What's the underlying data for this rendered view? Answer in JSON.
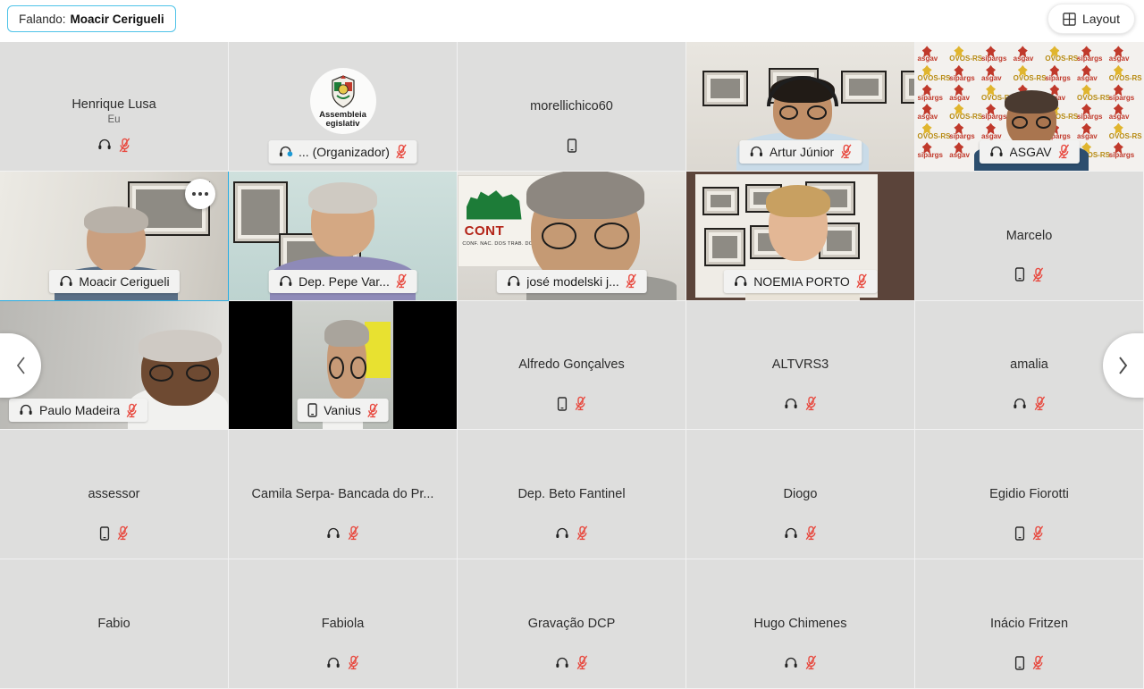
{
  "header": {
    "speaking_prefix": "Falando:",
    "speaking_name": "Moacir Cerigueli",
    "layout_label": "Layout",
    "layout_icon": "grid-layout-icon",
    "badge_border_color": "#4fc3e8"
  },
  "colors": {
    "active_speaker_border": "#2aace2",
    "muted_mic": "#e8493f",
    "tile_background": "#dededd",
    "plate_background": "#f2f2f1"
  },
  "nav": {
    "prev_label": "‹",
    "prev_icon": "chevron-left-icon",
    "next_label": "›",
    "next_icon": "chevron-right-icon"
  },
  "tile_menu": {
    "icon": "more-options-icon",
    "label": "..."
  },
  "grid": {
    "columns": 5,
    "rows": 5,
    "tiles": [
      {
        "name": "Henrique Lusa",
        "subtitle": "Eu",
        "video": false,
        "plate": false,
        "icons": [
          "headset-icon",
          "mic-muted-icon"
        ],
        "active_speaker": false
      },
      {
        "name": "... (Organizador)",
        "video": false,
        "plate": true,
        "avatar": "assembleia-legislativa-logo",
        "avatar_text": "Assembleia Legislativa",
        "icons": [
          "headset-active-icon",
          "mic-muted-icon"
        ],
        "active_speaker": false
      },
      {
        "name": "morellichico60",
        "video": false,
        "plate": false,
        "icons": [
          "phone-icon"
        ],
        "active_speaker": false
      },
      {
        "name": "Artur Júnior",
        "video": true,
        "plate": true,
        "scene": "s-artur",
        "icons": [
          "headset-icon",
          "mic-muted-icon"
        ],
        "active_speaker": false
      },
      {
        "name": "ASGAV",
        "video": true,
        "plate": true,
        "scene": "s-asgav",
        "icons": [
          "headset-icon",
          "mic-muted-icon"
        ],
        "active_speaker": false
      },
      {
        "name": "Moacir Cerigueli",
        "video": true,
        "plate": true,
        "scene": "s-moacir",
        "icons": [
          "headset-icon"
        ],
        "active_speaker": true,
        "menu": true
      },
      {
        "name": "Dep. Pepe Var...",
        "video": true,
        "plate": true,
        "scene": "s-pepe",
        "icons": [
          "headset-icon",
          "mic-muted-icon"
        ],
        "active_speaker": false
      },
      {
        "name": "josé modelski j...",
        "video": true,
        "plate": true,
        "scene": "s-jose",
        "icons": [
          "headset-icon",
          "mic-muted-icon"
        ],
        "active_speaker": false
      },
      {
        "name": "NOEMIA PORTO",
        "video": true,
        "plate": true,
        "scene": "s-noemia",
        "icons": [
          "headset-icon",
          "mic-muted-icon"
        ],
        "active_speaker": false
      },
      {
        "name": "Marcelo",
        "video": false,
        "plate": false,
        "icons": [
          "phone-icon",
          "mic-muted-icon"
        ],
        "active_speaker": false
      },
      {
        "name": "Paulo Madeira",
        "video": true,
        "plate": true,
        "plate_left": true,
        "scene": "s-paulo",
        "icons": [
          "headset-icon",
          "mic-muted-icon"
        ],
        "active_speaker": false
      },
      {
        "name": "Vanius",
        "video": true,
        "plate": true,
        "scene": "s-vanius",
        "icons": [
          "phone-icon",
          "mic-muted-icon"
        ],
        "active_speaker": false
      },
      {
        "name": "Alfredo Gonçalves",
        "video": false,
        "plate": false,
        "icons": [
          "phone-icon",
          "mic-muted-icon"
        ],
        "active_speaker": false
      },
      {
        "name": "ALTVRS3",
        "video": false,
        "plate": false,
        "icons": [
          "headset-icon",
          "mic-muted-icon"
        ],
        "active_speaker": false
      },
      {
        "name": "amalia",
        "video": false,
        "plate": false,
        "icons": [
          "headset-icon",
          "mic-muted-icon"
        ],
        "active_speaker": false
      },
      {
        "name": "assessor",
        "video": false,
        "plate": false,
        "icons": [
          "phone-icon",
          "mic-muted-icon"
        ],
        "active_speaker": false
      },
      {
        "name": "Camila Serpa- Bancada do Pr...",
        "video": false,
        "plate": false,
        "icons": [
          "headset-icon",
          "mic-muted-icon"
        ],
        "active_speaker": false
      },
      {
        "name": "Dep. Beto Fantinel",
        "video": false,
        "plate": false,
        "icons": [
          "headset-icon",
          "mic-muted-icon"
        ],
        "active_speaker": false
      },
      {
        "name": "Diogo",
        "video": false,
        "plate": false,
        "icons": [
          "headset-icon",
          "mic-muted-icon"
        ],
        "active_speaker": false
      },
      {
        "name": "Egidio Fiorotti",
        "video": false,
        "plate": false,
        "icons": [
          "phone-icon",
          "mic-muted-icon"
        ],
        "active_speaker": false
      },
      {
        "name": "Fabio",
        "video": false,
        "plate": false,
        "icons": [],
        "active_speaker": false
      },
      {
        "name": "Fabiola",
        "video": false,
        "plate": false,
        "icons": [
          "headset-icon",
          "mic-muted-icon"
        ],
        "active_speaker": false
      },
      {
        "name": "Gravação DCP",
        "video": false,
        "plate": false,
        "icons": [
          "headset-icon",
          "mic-muted-icon"
        ],
        "active_speaker": false
      },
      {
        "name": "Hugo Chimenes",
        "video": false,
        "plate": false,
        "icons": [
          "headset-icon",
          "mic-muted-icon"
        ],
        "active_speaker": false
      },
      {
        "name": "Inácio Fritzen",
        "video": false,
        "plate": false,
        "icons": [
          "phone-icon",
          "mic-muted-icon"
        ],
        "active_speaker": false
      }
    ]
  },
  "asgav_backdrop": {
    "logos": [
      "asgav",
      "OVOS-RS",
      "sipargs"
    ]
  }
}
